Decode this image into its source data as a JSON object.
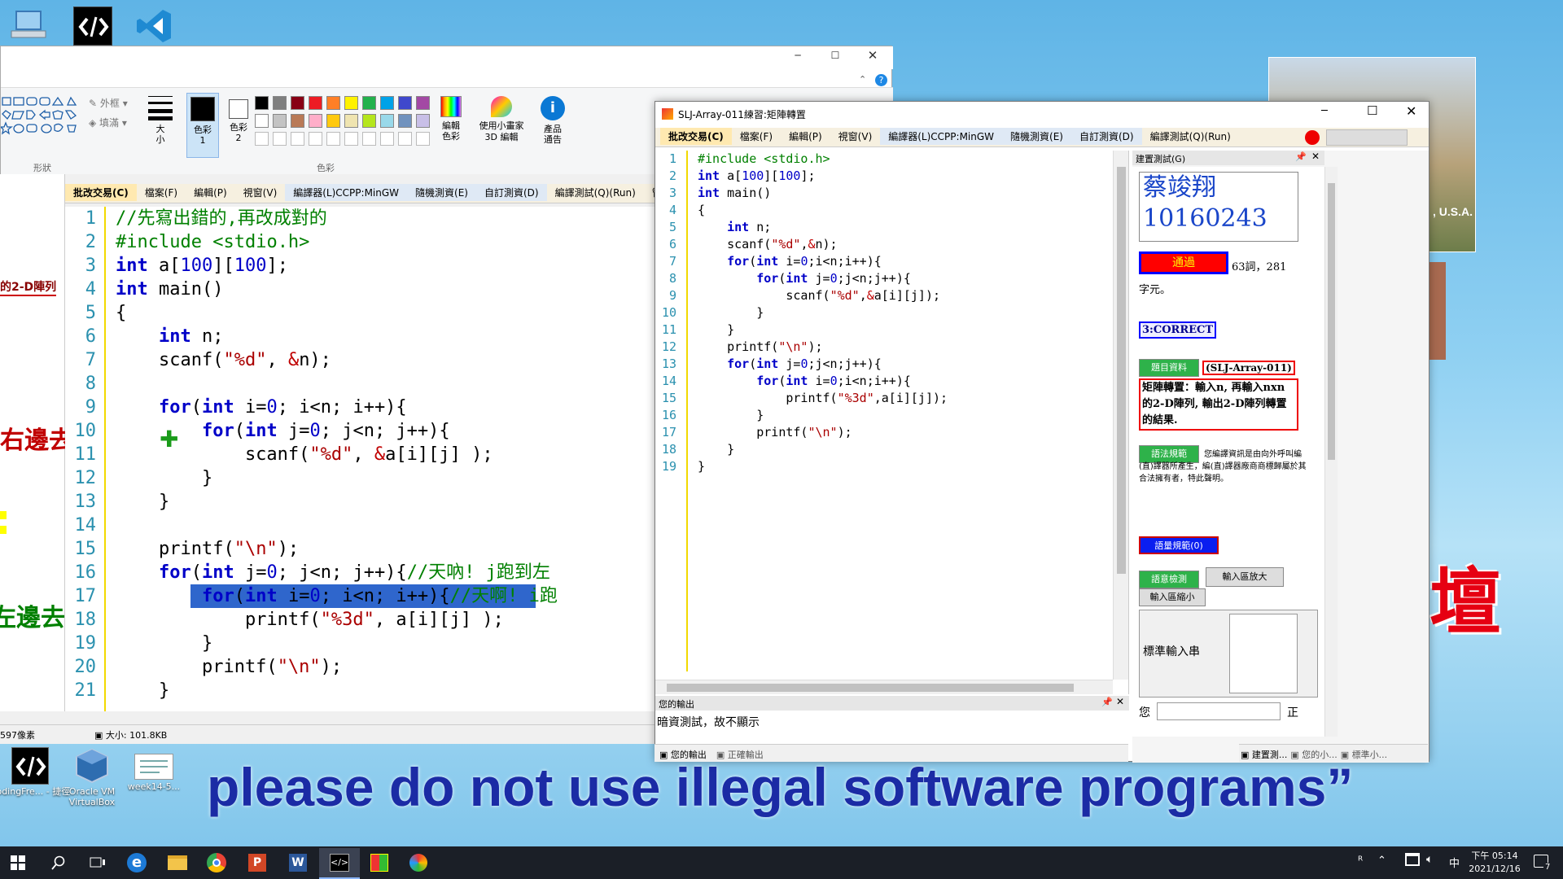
{
  "desktop": {
    "icons": [
      {
        "label": "CodingFre... - 捷徑"
      },
      {
        "label": "Oracle VM VirtualBox"
      },
      {
        "label": "week14-5..."
      }
    ],
    "caption": "please do not use illegal software programs”",
    "banner_text": "壇",
    "banner_sub": ", U.S.A."
  },
  "paint": {
    "shapes_label": "形狀",
    "outline_label": "外框",
    "fill_label": "填滿",
    "size_label": "大小",
    "color1_label": "色彩 1",
    "color2_label": "色彩 2",
    "colors_label": "色彩",
    "edit_colors_label": "編輯色彩",
    "paint3d_label": "使用小畫家 3D 編輯",
    "product_alert_label": "產品通告",
    "status_pixels": "597像素",
    "status_size": "大小: 101.8KB",
    "palette": [
      "#000000",
      "#7f7f7f",
      "#880015",
      "#ed1c24",
      "#ff7f27",
      "#fff200",
      "#22b14c",
      "#00a2e8",
      "#3f48cc",
      "#a349a4",
      "#ffffff",
      "#c3c3c3",
      "#b97a57",
      "#ffaec9",
      "#ffc90e",
      "#efe4b0",
      "#b5e61d",
      "#99d9ea",
      "#7092be",
      "#c8bfe7"
    ]
  },
  "left_editor": {
    "menu": [
      "批改交易(C)",
      "檔案(F)",
      "編輯(P)",
      "視窗(V)",
      "編譯器(L)CCPP:MinGW",
      "隨機測資(E)",
      "自訂測資(D)",
      "編譯測試(Q)(Run)",
      "管"
    ],
    "lines": [
      {
        "n": "1",
        "t": "//先寫出錯的,再改成對的"
      },
      {
        "n": "2",
        "t": "#include <stdio.h>"
      },
      {
        "n": "3",
        "t": "int a[100][100];"
      },
      {
        "n": "4",
        "t": "int main()"
      },
      {
        "n": "5",
        "t": "{"
      },
      {
        "n": "6",
        "t": "    int n;"
      },
      {
        "n": "7",
        "t": "    scanf(\"%d\", &n);"
      },
      {
        "n": "8",
        "t": ""
      },
      {
        "n": "9",
        "t": "    for(int i=0; i<n; i++){"
      },
      {
        "n": "10",
        "t": "        for(int j=0; j<n; j++){"
      },
      {
        "n": "11",
        "t": "            scanf(\"%d\", &a[i][j] );"
      },
      {
        "n": "12",
        "t": "        }"
      },
      {
        "n": "13",
        "t": "    }"
      },
      {
        "n": "14",
        "t": ""
      },
      {
        "n": "15",
        "t": "    printf(\"\\n\");"
      },
      {
        "n": "16",
        "t": "    for(int j=0; j<n; j++){//天吶! j跑到左"
      },
      {
        "n": "17",
        "t": "        for(int i=0; i<n; i++){//天啊! i跑"
      },
      {
        "n": "18",
        "t": "            printf(\"%3d\", a[i][j] );"
      },
      {
        "n": "19",
        "t": "        }"
      },
      {
        "n": "20",
        "t": "        printf(\"\\n\");"
      },
      {
        "n": "21",
        "t": "    }"
      }
    ],
    "side_texts": [
      "的2-D陣列",
      "右邊去",
      "左邊去"
    ]
  },
  "sj_window": {
    "title": "SLJ-Array-011練習:矩陣轉置",
    "menu": [
      "批改交易(C)",
      "檔案(F)",
      "編輯(P)",
      "視窗(V)",
      "編譯器(L)CCPP:MinGW",
      "隨機測資(E)",
      "自訂測資(D)",
      "編譯測試(Q)(Run)"
    ],
    "lines": [
      {
        "n": "1",
        "t": "#include <stdio.h>"
      },
      {
        "n": "2",
        "t": "int a[100][100];"
      },
      {
        "n": "3",
        "t": "int main()"
      },
      {
        "n": "4",
        "t": "{"
      },
      {
        "n": "5",
        "t": "    int n;"
      },
      {
        "n": "6",
        "t": "    scanf(\"%d\",&n);"
      },
      {
        "n": "7",
        "t": "    for(int i=0;i<n;i++){"
      },
      {
        "n": "8",
        "t": "        for(int j=0;j<n;j++){"
      },
      {
        "n": "9",
        "t": "            scanf(\"%d\",&a[i][j]);"
      },
      {
        "n": "10",
        "t": "        }"
      },
      {
        "n": "11",
        "t": "    }"
      },
      {
        "n": "12",
        "t": "    printf(\"\\n\");"
      },
      {
        "n": "13",
        "t": "    for(int j=0;j<n;j++){"
      },
      {
        "n": "14",
        "t": "        for(int i=0;i<n;i++){"
      },
      {
        "n": "15",
        "t": "            printf(\"%3d\",a[i][j]);"
      },
      {
        "n": "16",
        "t": "        }"
      },
      {
        "n": "17",
        "t": "        printf(\"\\n\");"
      },
      {
        "n": "18",
        "t": "    }"
      },
      {
        "n": "19",
        "t": "}"
      }
    ],
    "output_title": "您的輸出",
    "output_text": "暗資測試，故不顯示",
    "bottom_tabs": [
      "您的輸出",
      "正確輸出"
    ],
    "right_panel": {
      "title": "建置測試(G)",
      "student_name": "蔡竣翔",
      "student_id": "10160243",
      "pass_label": "通過",
      "pass_info": "63詞，281",
      "pass_info2": "字元。",
      "correct_label": "3:CORRECT",
      "problem_btn": "題目資料",
      "problem_id": "(SLJ-Array-011)",
      "problem_desc": "矩陣轉置：輸入n, 再輸入nxn的2-D陣列, 輸出2-D陣列轉置的結果.",
      "syntax_btn": "語法規範",
      "syntax_desc": "您編譯資訊是由向外呼叫編(直)譯器所產生，編(直)譯器廠商商標歸屬於其合法擁有者，特此聲明。",
      "semantic_btn": "語量規範(0)",
      "sem_check_btn": "語意檢測",
      "input_enlarge_btn": "輸入區放大",
      "input_shrink_btn": "輸入區縮小",
      "stdin_label": "標準輸入串",
      "bottom_left": "您",
      "bottom_right": "正",
      "bottom_tabs": [
        "建置測...",
        "您的小...",
        "標準小..."
      ]
    }
  },
  "taskbar": {
    "time": "下午 05:14",
    "date": "2021/12/16",
    "notif_count": "7"
  }
}
